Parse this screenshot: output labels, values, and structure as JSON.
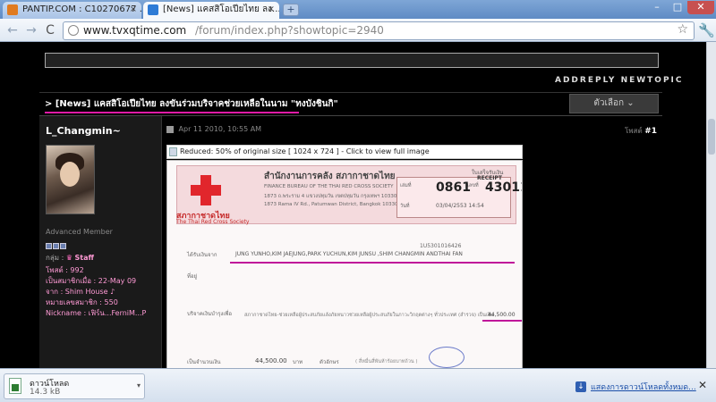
{
  "browser": {
    "tabs": [
      {
        "label": "PANTIP.COM : C10270677 ...",
        "favicon_color": "#e07b20"
      },
      {
        "label": "[News] แคสสิโอเปียไทย ลง...",
        "favicon_color": "#2e7bd6"
      }
    ],
    "new_tab_symbol": "+",
    "window_controls": [
      "–",
      "□",
      "✕"
    ],
    "back_symbol": "←",
    "forward_symbol": "→",
    "reload_symbol": "C",
    "url_domain": "www.tvxqtime.com",
    "url_path": "/forum/index.php?showtopic=2940",
    "star_symbol": "☆",
    "wrench_symbol": "🔧"
  },
  "forum": {
    "reply_links": "ADDREPLY  NEWTOPIC",
    "thread_title": "> [News] แคสสิโอเปียไทย ลงขันร่วมบริจาคช่วยเหลือในนาม \"ทงบังชินกิ\"",
    "options_label": "ตัวเลือก ⌄",
    "post": {
      "username": "L_Changmin~",
      "rank": "Advanced Member",
      "group_label": "กลุ่ม :",
      "group": "Staff",
      "posts": "โพสต์ : 992",
      "joined": "เป็นสมาชิกเมื่อ : 22-May 09",
      "from": "จาก : Shim House ♪",
      "member_no": "หมายเลขสมาชิก : 550",
      "nickname": "Nickname : เฟิร์น...FerniM...P",
      "date": "Apr 11 2010, 10:55 AM",
      "post_label": "โพสต์",
      "post_number": "#1"
    },
    "image_caption": "Reduced: 50% of original size [ 1024 x 724 ] - Click to view full image",
    "receipt": {
      "org_title_th": "สำนักงานการคลัง สภากาชาดไทย",
      "org_title_en": "FINANCE BUREAU OF THE THAI RED CROSS SOCIETY",
      "address_th": "1873 ถ.พระราม 4 แขวงปทุมวัน เขตปทุมวัน กรุงเทพฯ 10330",
      "address_en": "1873 Rama IV Rd., Patumwan District, Bangkok 10330",
      "org_th": "สภากาชาดไทย",
      "org_en": "The Thai Red Cross Society",
      "receipt_th": "ใบเสร็จรับเงิน",
      "receipt_en": "RECEIPT",
      "book_no_label": "เล่มที่",
      "book_no": "0861",
      "no_label": "เลขที่",
      "no": "43011",
      "date_label": "วันที่",
      "date": "03/04/2553 14:54",
      "ref": "1U5301016426",
      "donated_by_label": "ได้รับเงินจาก",
      "donated_by": "JUNG YUNHO,KIM JAEJUNG,PARK YUCHUN,KIM JUNSU ,SHIM CHANGMIN ANDTHAI FAN",
      "address_label": "ที่อยู่",
      "purpose_label": "บริจาคเงินบำรุงเพื่อ",
      "purpose": "สภากาชาดไทย-ช่วยเหลือผู้ประสบภัยแล้งภัยหนาวช่วยเหลือผู้ประสบภัยในภาวะวิกฤตต่างๆ ทั่วประเทศ (สำรวจ) เป็นเงิน",
      "amount_line": "44,500.00",
      "amount_label": "เป็นจำนวนเงิน",
      "amount": "44,500.00",
      "baht": "บาท",
      "letters_label": "ตัวอักษร",
      "letters": "( สี่หมื่นสี่พันห้าร้อยบาทถ้วน )"
    }
  },
  "downloads": {
    "item_name": "ดาวน์โหลด",
    "item_size": "14.3 kB",
    "menu_symbol": "▾",
    "show_all": "แสดงการดาวน์โหลดทั้งหมด...",
    "close_symbol": "✕"
  },
  "colors": {
    "underline": "#e01aa6",
    "group_text": "#ff9ad5",
    "red_cross": "#e1262c"
  }
}
